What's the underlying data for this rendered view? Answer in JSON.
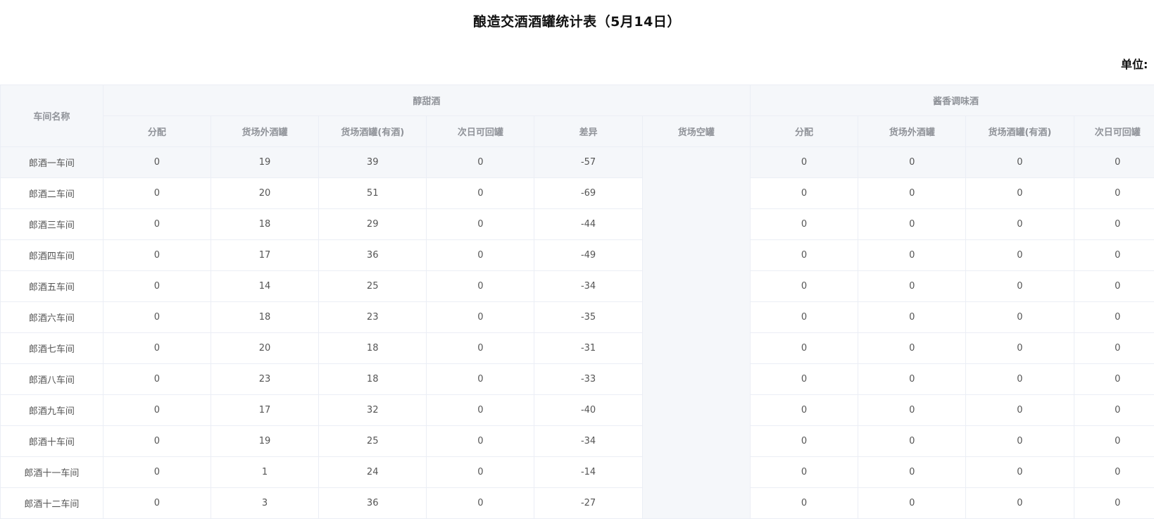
{
  "title": "酿造交酒酒罐统计表（5月14日）",
  "unit_label": "单位:",
  "header": {
    "workshop": "车间名称",
    "group1": "醇甜酒",
    "group2": "酱香调味酒",
    "cols": [
      "分配",
      "货场外酒罐",
      "货场酒罐(有酒)",
      "次日可回罐",
      "差异",
      "货场空罐",
      "分配",
      "货场外酒罐",
      "货场酒罐(有酒)",
      "次日可回罐"
    ]
  },
  "rows": [
    {
      "name": "郎酒一车间",
      "v": [
        "0",
        "19",
        "39",
        "0",
        "-57",
        "0",
        "0",
        "0",
        "0"
      ]
    },
    {
      "name": "郎酒二车间",
      "v": [
        "0",
        "20",
        "51",
        "0",
        "-69",
        "0",
        "0",
        "0",
        "0"
      ]
    },
    {
      "name": "郎酒三车间",
      "v": [
        "0",
        "18",
        "29",
        "0",
        "-44",
        "0",
        "0",
        "0",
        "0"
      ]
    },
    {
      "name": "郎酒四车间",
      "v": [
        "0",
        "17",
        "36",
        "0",
        "-49",
        "0",
        "0",
        "0",
        "0"
      ]
    },
    {
      "name": "郎酒五车间",
      "v": [
        "0",
        "14",
        "25",
        "0",
        "-34",
        "0",
        "0",
        "0",
        "0"
      ]
    },
    {
      "name": "郎酒六车间",
      "v": [
        "0",
        "18",
        "23",
        "0",
        "-35",
        "0",
        "0",
        "0",
        "0"
      ]
    },
    {
      "name": "郎酒七车间",
      "v": [
        "0",
        "20",
        "18",
        "0",
        "-31",
        "0",
        "0",
        "0",
        "0"
      ]
    },
    {
      "name": "郎酒八车间",
      "v": [
        "0",
        "23",
        "18",
        "0",
        "-33",
        "0",
        "0",
        "0",
        "0"
      ]
    },
    {
      "name": "郎酒九车间",
      "v": [
        "0",
        "17",
        "32",
        "0",
        "-40",
        "0",
        "0",
        "0",
        "0"
      ]
    },
    {
      "name": "郎酒十车间",
      "v": [
        "0",
        "19",
        "25",
        "0",
        "-34",
        "0",
        "0",
        "0",
        "0"
      ]
    },
    {
      "name": "郎酒十一车间",
      "v": [
        "0",
        "1",
        "24",
        "0",
        "-14",
        "0",
        "0",
        "0",
        "0"
      ]
    },
    {
      "name": "郎酒十二车间",
      "v": [
        "0",
        "3",
        "36",
        "0",
        "-27",
        "0",
        "0",
        "0",
        "0"
      ]
    }
  ]
}
